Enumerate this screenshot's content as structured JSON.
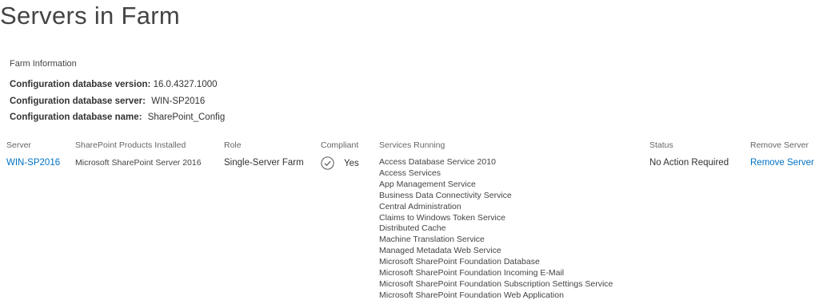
{
  "page_title": "Servers in Farm",
  "farm_info": {
    "heading": "Farm Information",
    "rows": [
      {
        "label": "Configuration database version:",
        "value": "16.0.4327.1000"
      },
      {
        "label": "Configuration database server:",
        "value": "WIN-SP2016"
      },
      {
        "label": "Configuration database name:",
        "value": "SharePoint_Config"
      }
    ]
  },
  "table": {
    "columns": {
      "server": "Server",
      "products": "SharePoint Products Installed",
      "role": "Role",
      "compliant": "Compliant",
      "services": "Services Running",
      "status": "Status",
      "remove": "Remove Server"
    },
    "row": {
      "server": "WIN-SP2016",
      "products": "Microsoft SharePoint Server 2016",
      "role": "Single-Server Farm",
      "compliant": "Yes",
      "compliant_icon": "check-circle-icon",
      "services": [
        "Access Database Service 2010",
        "Access Services",
        "App Management Service",
        "Business Data Connectivity Service",
        "Central Administration",
        "Claims to Windows Token Service",
        "Distributed Cache",
        "Machine Translation Service",
        "Managed Metadata Web Service",
        "Microsoft SharePoint Foundation Database",
        "Microsoft SharePoint Foundation Incoming E-Mail",
        "Microsoft SharePoint Foundation Subscription Settings Service",
        "Microsoft SharePoint Foundation Web Application"
      ],
      "status": "No Action Required",
      "remove": "Remove Server"
    }
  },
  "colors": {
    "link": "#0072c6",
    "text": "#444444",
    "header_text": "#666666"
  }
}
